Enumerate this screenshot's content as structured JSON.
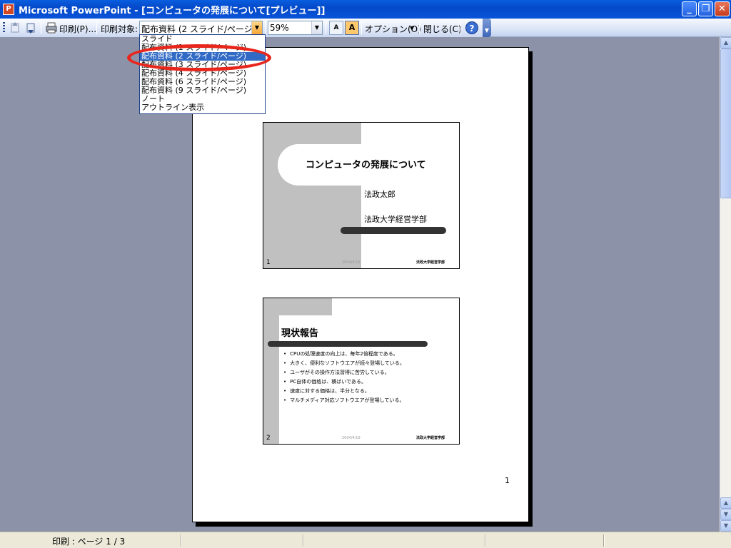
{
  "window": {
    "title": "Microsoft PowerPoint - [コンピュータの発展について[プレビュー]]",
    "app_icon": "P",
    "controls": {
      "minimize": "_",
      "restore": "❐",
      "close": "✕"
    }
  },
  "toolbar": {
    "print_label": "印刷(P)...",
    "print_what_label": "印刷対象:",
    "print_what_value": "配布資料 (2 スライド/ページ)",
    "zoom_value": "59%",
    "options_label": "オプション(O)",
    "close_label": "閉じる(C)",
    "help_glyph": "?",
    "color_toggle_glyph": "A"
  },
  "dropdown": {
    "items": [
      "スライド",
      "配布資料 (1 スライド/ページ)",
      "配布資料 (2 スライド/ページ)",
      "配布資料 (3 スライド/ページ)",
      "配布資料 (4 スライド/ページ)",
      "配布資料 (6 スライド/ページ)",
      "配布資料 (9 スライド/ページ)",
      "ノート",
      "アウトライン表示"
    ],
    "selected_index": 2
  },
  "page": {
    "number": "1",
    "slides": [
      {
        "num": "1",
        "title": "コンピュータの発展について",
        "subtitle1": "法政太郎",
        "subtitle2": "法政大学経営学部",
        "date": "2004/4/19",
        "footer": "法政大学経営学部"
      },
      {
        "num": "2",
        "title": "現状報告",
        "bullets": [
          "CPUの処理速度の向上は、毎年2倍程度である。",
          "大きく、便利なソフトウエアが続々登場している。",
          "ユーザがその操作方法習得に苦労している。",
          "PC自体の価格は、横ばいである。",
          "速度に対する価格は、半分となる。",
          "マルチメディア対応ソフトウエアが登場している。"
        ],
        "date": "2004/4/19",
        "footer": "法政大学経営学部"
      }
    ]
  },
  "status": {
    "text": "印刷 : ページ 1 / 3"
  },
  "colors": {
    "highlight": "#316ac5",
    "annotation_ellipse": "#e8261c",
    "workspace_bg": "#8c93a8"
  }
}
